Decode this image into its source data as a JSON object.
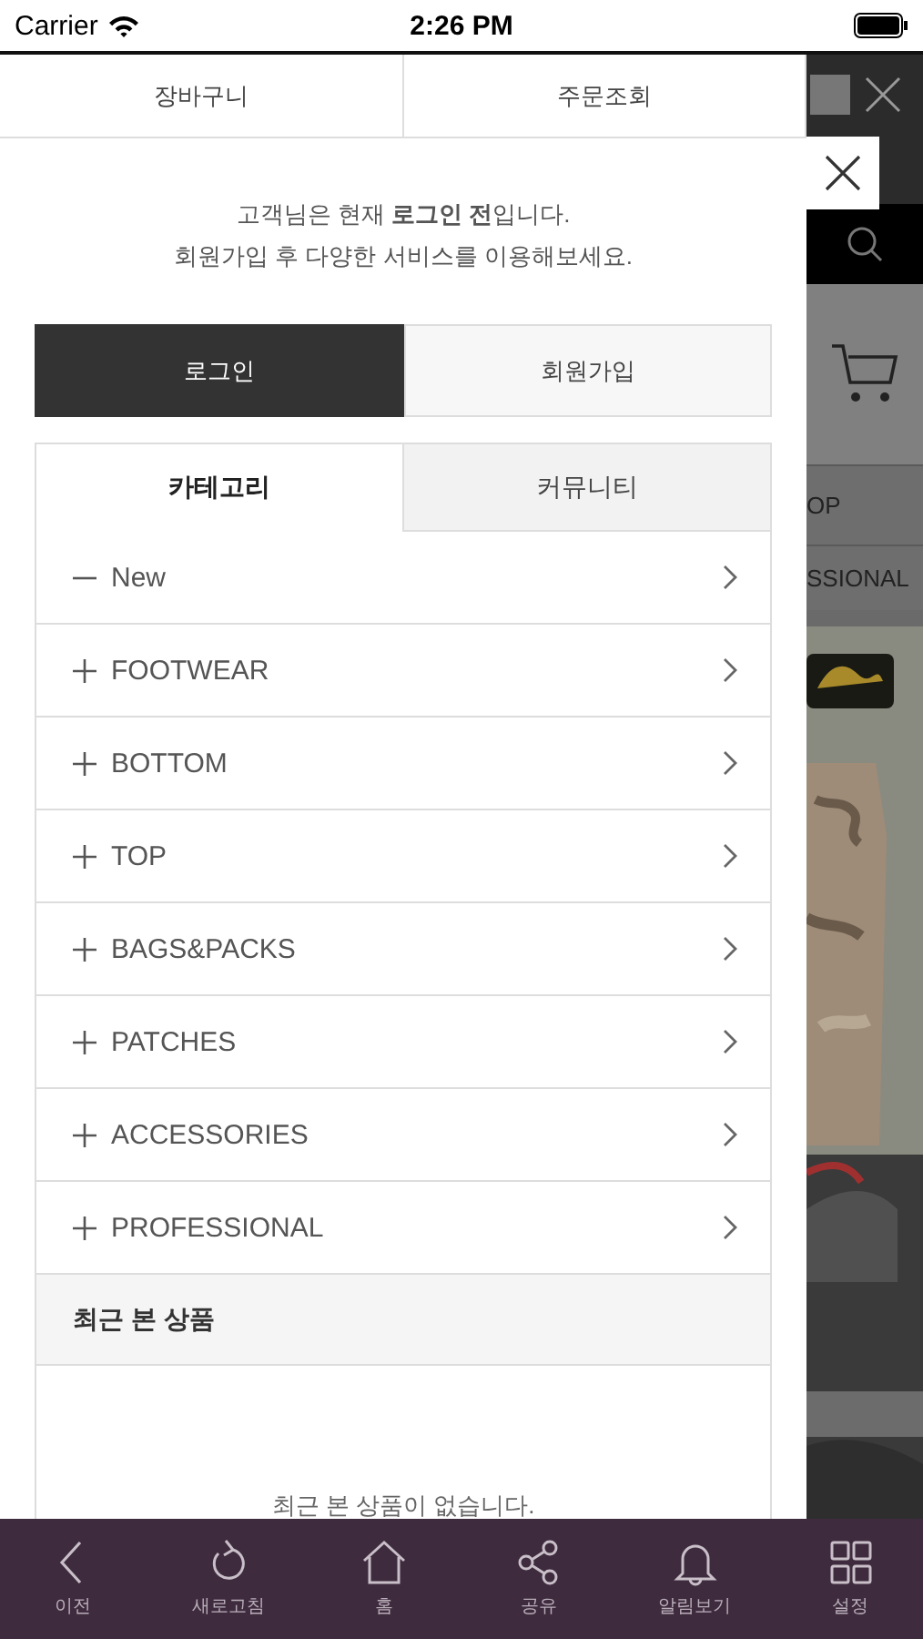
{
  "status_bar": {
    "carrier": "Carrier",
    "time": "2:26 PM"
  },
  "drawer": {
    "top_links": [
      "장바구니",
      "주문조회"
    ],
    "notice": [
      "고객님은 현재 **로그인 전**입니다.",
      "회원가입 후 다양한 서비스를 이용해보세요."
    ],
    "auth_buttons": [
      {
        "label": "로그인",
        "selected": true
      },
      {
        "label": "회원가입",
        "selected": false
      }
    ],
    "tabs": [
      {
        "label": "카테고리",
        "selected": true
      },
      {
        "label": "커뮤니티",
        "selected": false
      }
    ],
    "categories": [
      {
        "label": "New",
        "expanded": true
      },
      {
        "label": "FOOTWEAR",
        "expanded": false
      },
      {
        "label": "BOTTOM",
        "expanded": false
      },
      {
        "label": "TOP",
        "expanded": false
      },
      {
        "label": "BAGS&PACKS",
        "expanded": false
      },
      {
        "label": "PATCHES",
        "expanded": false
      },
      {
        "label": "ACCESSORIES",
        "expanded": false
      },
      {
        "label": "PROFESSIONAL",
        "expanded": false
      }
    ],
    "recent": {
      "title": "최근 본 상품",
      "empty_message": "최근 본 상품이 없습니다."
    }
  },
  "background_page": {
    "menu_items": [
      "OP",
      "SSIONAL"
    ]
  },
  "bottom_bar": [
    {
      "label": "이전",
      "kind": "back"
    },
    {
      "label": "새로고침",
      "kind": "refresh"
    },
    {
      "label": "홈",
      "kind": "home"
    },
    {
      "label": "공유",
      "kind": "share"
    },
    {
      "label": "알림보기",
      "kind": "bell"
    },
    {
      "label": "설정",
      "kind": "grid"
    }
  ]
}
